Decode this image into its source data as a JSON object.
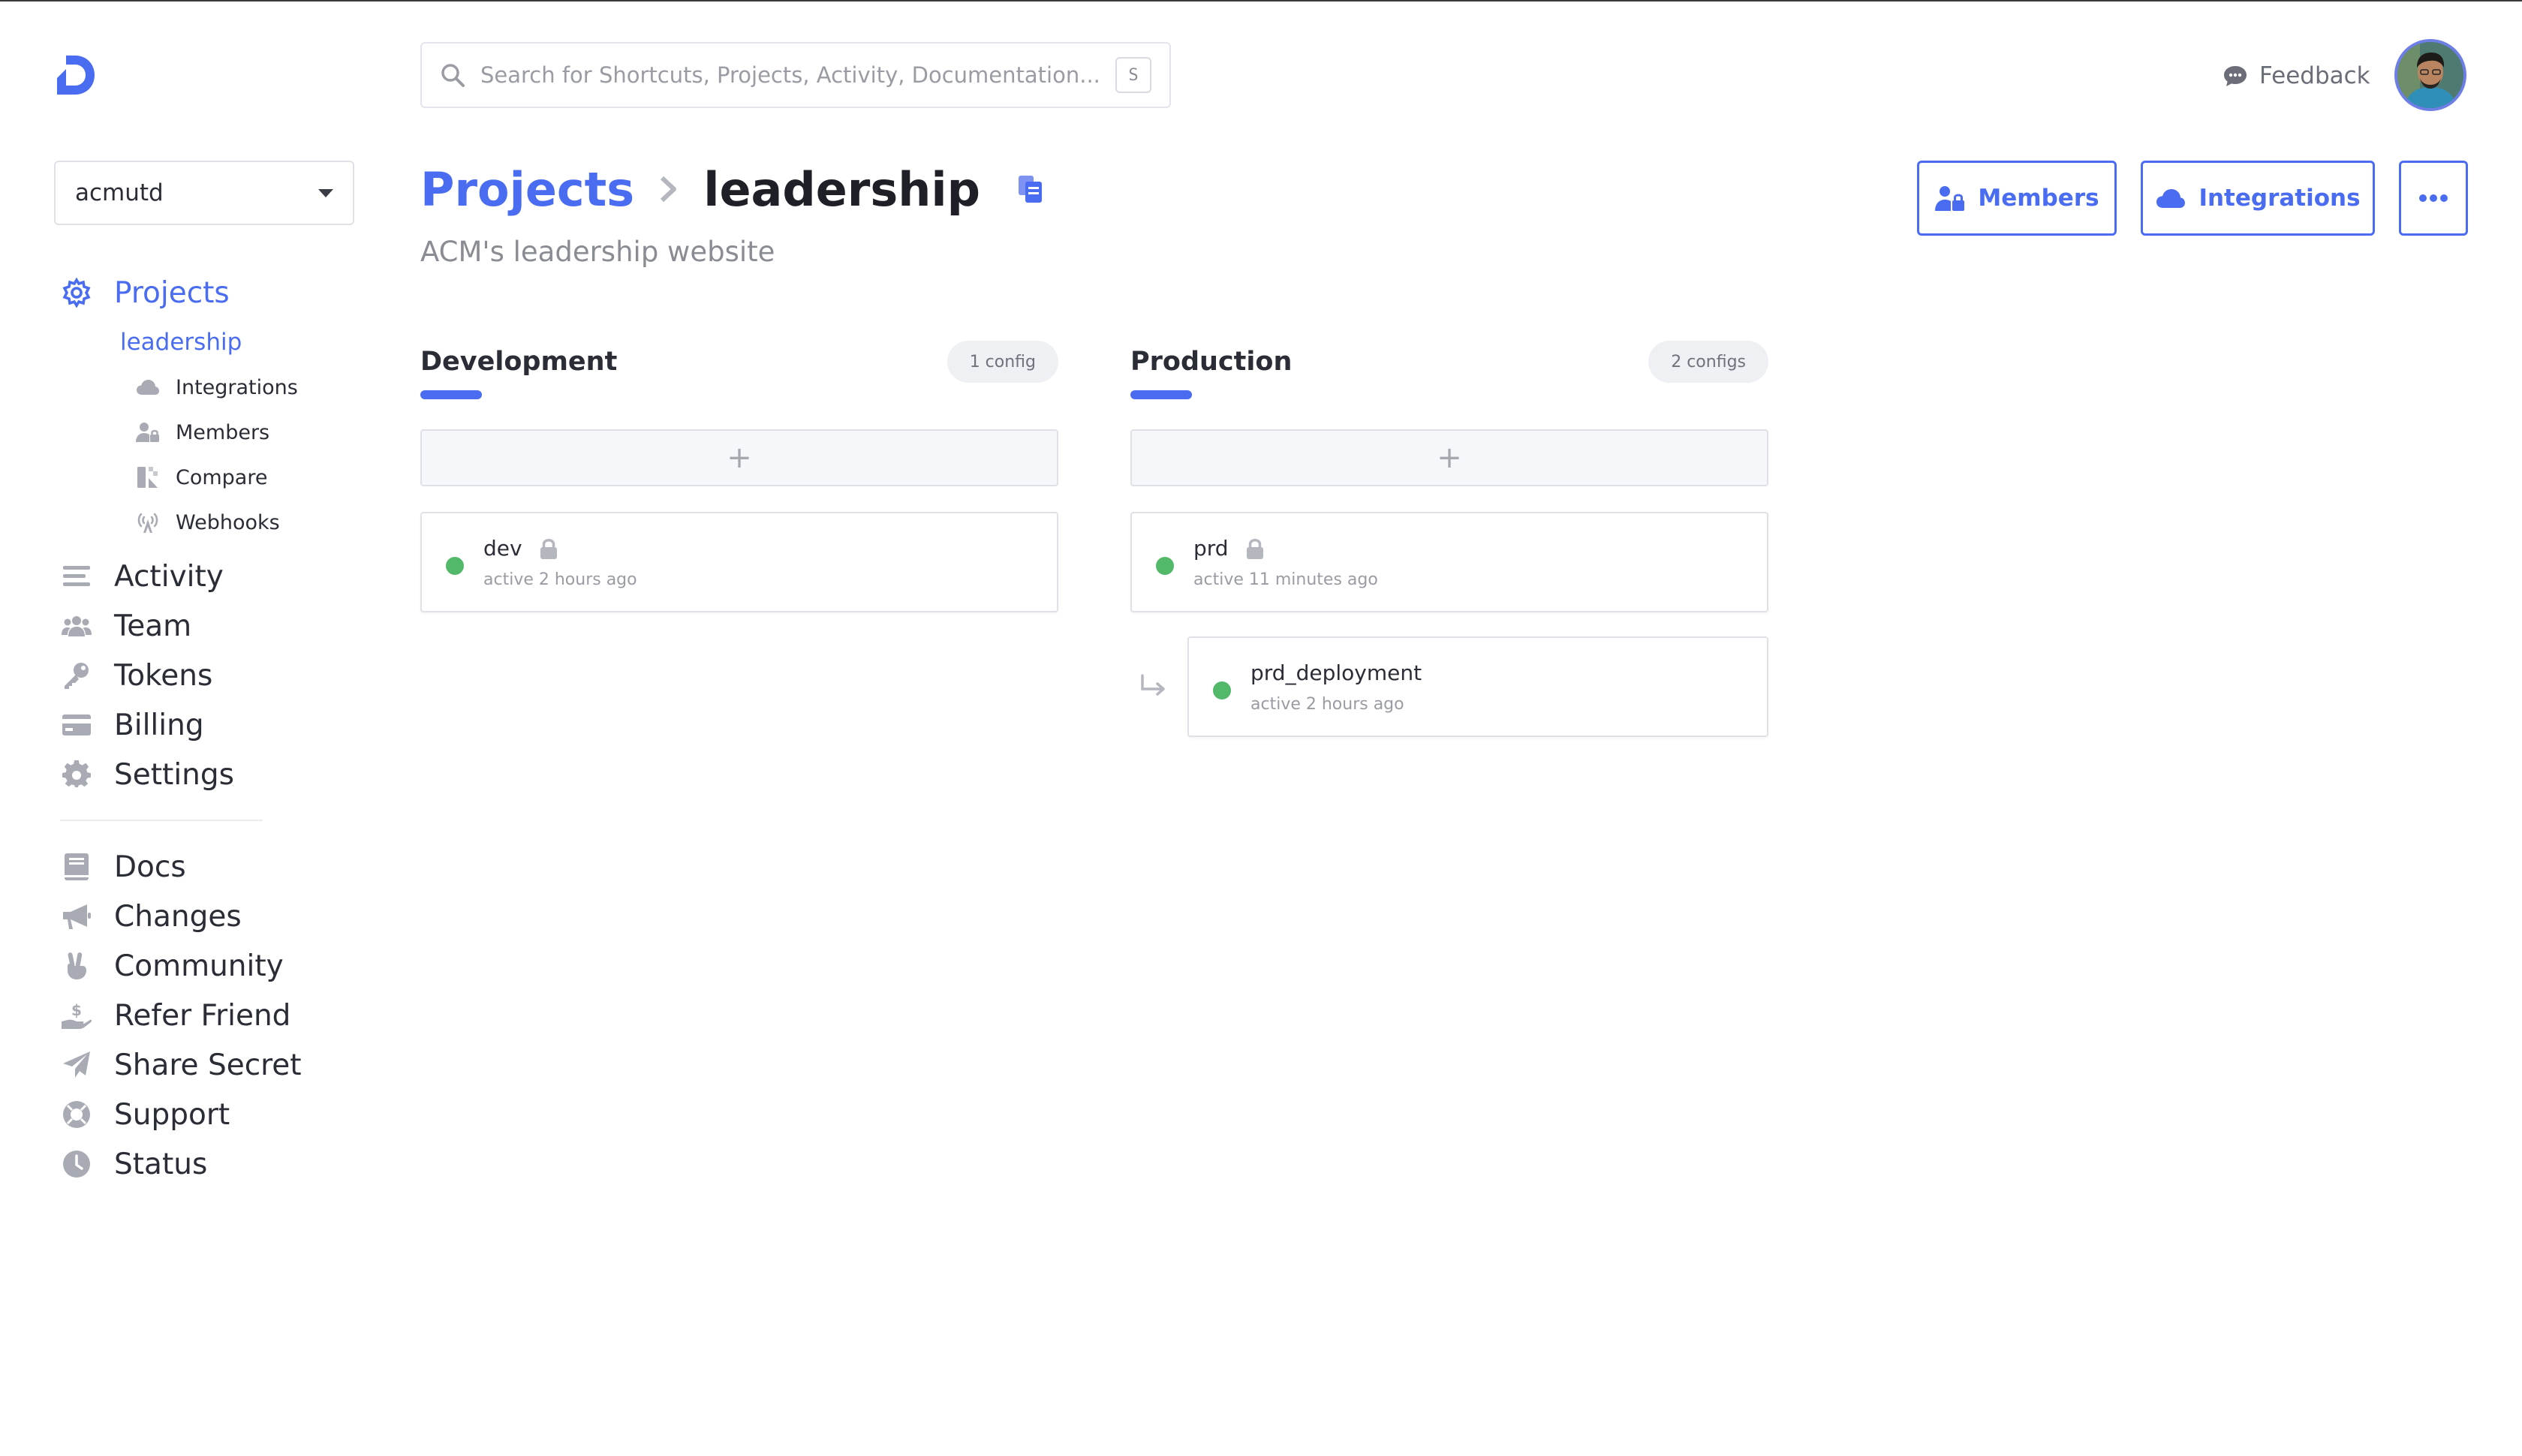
{
  "app": {
    "brand_color": "#4a6cf0",
    "status_active_color": "#52b86a"
  },
  "header": {
    "search_placeholder": "Search for Shortcuts, Projects, Activity, Documentation...",
    "search_shortcut": "S",
    "feedback_label": "Feedback"
  },
  "sidebar": {
    "workspace": "acmutd",
    "primary": [
      {
        "label": "Projects",
        "icon": "projects-icon",
        "active": true
      },
      {
        "label": "Activity",
        "icon": "activity-icon"
      },
      {
        "label": "Team",
        "icon": "team-icon"
      },
      {
        "label": "Tokens",
        "icon": "key-icon"
      },
      {
        "label": "Billing",
        "icon": "credit-card-icon"
      },
      {
        "label": "Settings",
        "icon": "gear-icon"
      }
    ],
    "project": "leadership",
    "project_sub": [
      {
        "label": "Integrations",
        "icon": "cloud-icon"
      },
      {
        "label": "Members",
        "icon": "members-icon"
      },
      {
        "label": "Compare",
        "icon": "compare-icon"
      },
      {
        "label": "Webhooks",
        "icon": "broadcast-icon"
      }
    ],
    "secondary": [
      {
        "label": "Docs",
        "icon": "book-icon"
      },
      {
        "label": "Changes",
        "icon": "megaphone-icon"
      },
      {
        "label": "Community",
        "icon": "peace-hand-icon"
      },
      {
        "label": "Refer Friend",
        "icon": "refer-icon"
      },
      {
        "label": "Share Secret",
        "icon": "paper-plane-icon"
      },
      {
        "label": "Support",
        "icon": "lifebuoy-icon"
      },
      {
        "label": "Status",
        "icon": "clock-icon"
      }
    ]
  },
  "page": {
    "breadcrumb_root": "Projects",
    "project_name": "leadership",
    "description": "ACM's leadership website",
    "buttons": {
      "members": "Members",
      "integrations": "Integrations"
    }
  },
  "environments": [
    {
      "name": "Development",
      "count_label": "1 config",
      "add_label": "+",
      "configs": [
        {
          "name": "dev",
          "status": "active 2 hours ago",
          "locked": true
        }
      ]
    },
    {
      "name": "Production",
      "count_label": "2 configs",
      "add_label": "+",
      "configs": [
        {
          "name": "prd",
          "status": "active 11 minutes ago",
          "locked": true
        },
        {
          "name": "prd_deployment",
          "status": "active 2 hours ago",
          "locked": false,
          "branch": true
        }
      ]
    }
  ]
}
